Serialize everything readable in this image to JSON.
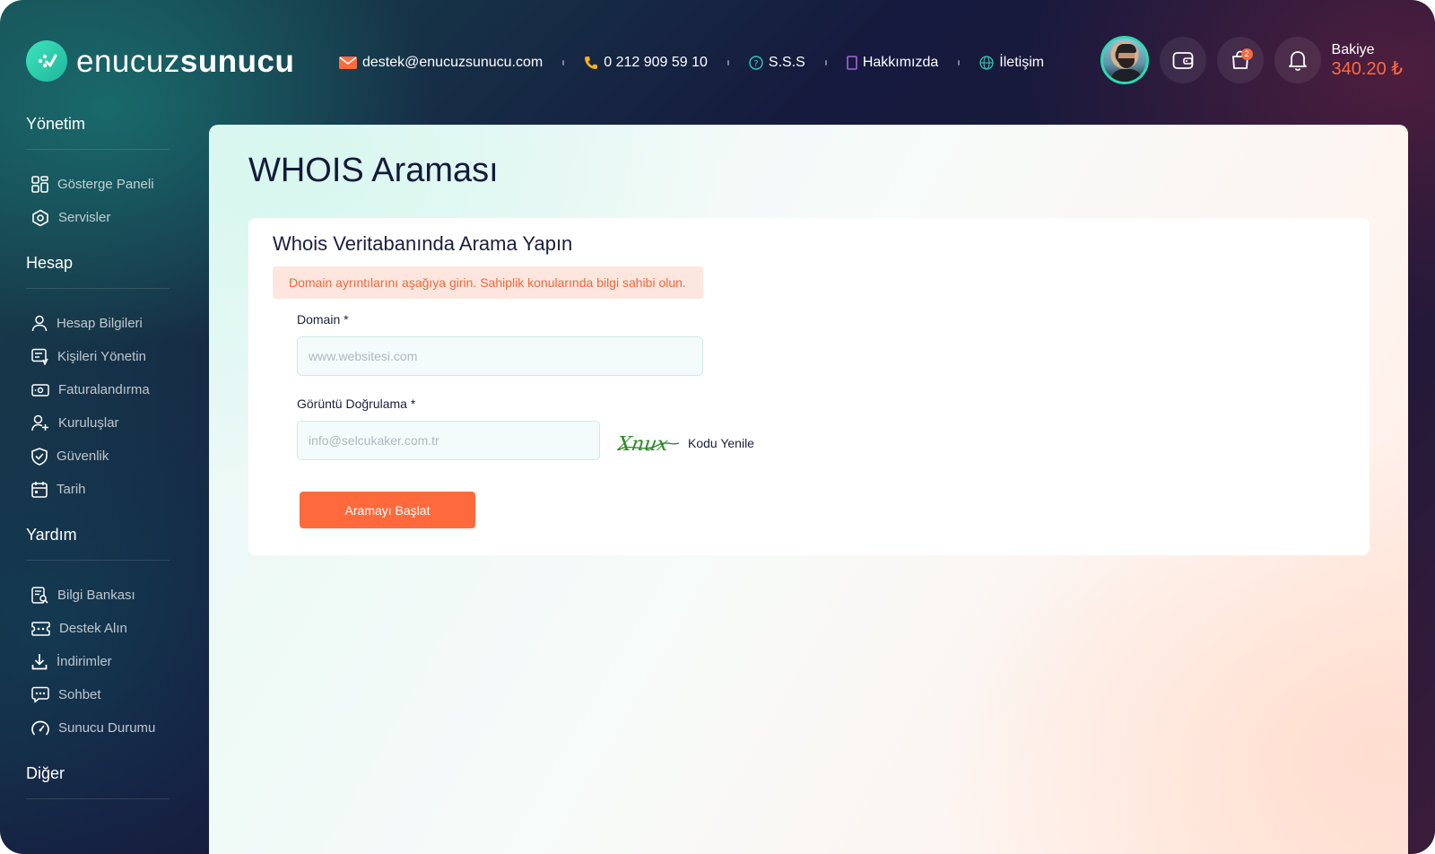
{
  "brand": {
    "light": "enucuz",
    "bold": "sunucu"
  },
  "topnav": {
    "email": "destek@enucuzsunucu.com",
    "phone": "0 212 909 59 10",
    "faq": "S.S.S",
    "about": "Hakkımızda",
    "contact": "İletişim"
  },
  "header": {
    "cart_count": "2",
    "balance_label": "Bakiye",
    "balance_value": "340.20 ₺"
  },
  "sidebar": {
    "management": {
      "title": "Yönetim",
      "items": [
        {
          "label": "Gösterge Paneli",
          "icon": "grid-icon"
        },
        {
          "label": "Servisler",
          "icon": "services-icon"
        }
      ]
    },
    "account": {
      "title": "Hesap",
      "items": [
        {
          "label": "Hesap Bilgileri",
          "icon": "user-icon"
        },
        {
          "label": "Kişileri Yönetin",
          "icon": "contacts-icon"
        },
        {
          "label": "Faturalandırma",
          "icon": "billing-icon"
        },
        {
          "label": "Kuruluşlar",
          "icon": "user-add-icon"
        },
        {
          "label": "Güvenlik",
          "icon": "shield-icon"
        },
        {
          "label": "Tarih",
          "icon": "calendar-icon"
        }
      ]
    },
    "help": {
      "title": "Yardım",
      "items": [
        {
          "label": "Bilgi Bankası",
          "icon": "knowledge-icon"
        },
        {
          "label": "Destek Alın",
          "icon": "ticket-icon"
        },
        {
          "label": "İndirimler",
          "icon": "download-icon"
        },
        {
          "label": "Sohbet",
          "icon": "chat-icon"
        },
        {
          "label": "Sunucu Durumu",
          "icon": "gauge-icon"
        }
      ]
    },
    "other": {
      "title": "Diğer"
    }
  },
  "main": {
    "page_title": "WHOIS Araması",
    "card_title": "Whois Veritabanında Arama Yapın",
    "alert": "Domain ayrıntılarını aşağıya girin. Sahiplik konularında bilgi sahibi olun.",
    "domain_label": "Domain *",
    "domain_placeholder": "www.websitesi.com",
    "captcha_label": "Görüntü Doğrulama *",
    "captcha_placeholder": "info@selcukaker.com.tr",
    "captcha_text": "Xnux",
    "refresh_label": "Kodu Yenile",
    "submit_label": "Aramayı Başlat"
  },
  "colors": {
    "accent": "#ff6a3d",
    "brand_teal": "#2fd9b3",
    "title_dark": "#141a3a"
  }
}
